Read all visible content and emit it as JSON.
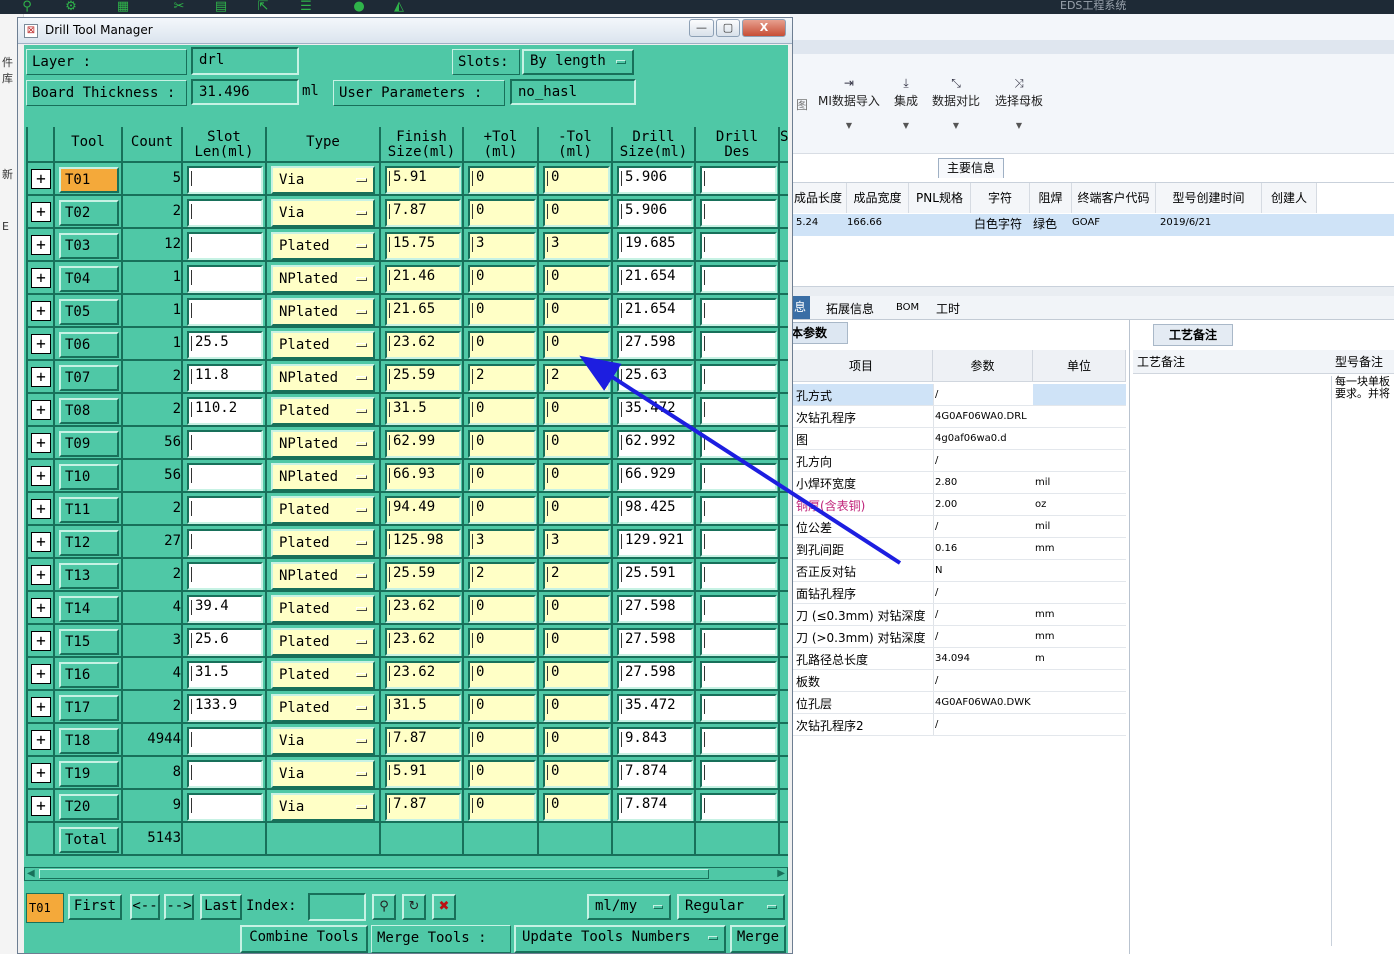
{
  "background_app": {
    "title": "EDS工程系统",
    "left_strip": [
      "件库",
      "新",
      "E"
    ],
    "ribbon": [
      {
        "label": "MI数据导入"
      },
      {
        "label": "集成"
      },
      {
        "label": "数据对比"
      },
      {
        "label": "选择母板"
      }
    ],
    "ribbon_partial": "图",
    "main_info_tab": "主要信息",
    "info_columns": [
      "成品长度",
      "成品宽度",
      "PNL规格",
      "字符",
      "阻焊",
      "终端客户代码",
      "型号创建时间",
      "创建人"
    ],
    "info_row": {
      "length": "5.24",
      "width": "166.66",
      "char": "白色字符",
      "mask": "绿色",
      "client": "GOAF",
      "created": "2019/6/21"
    },
    "bottom_tabs": [
      "息",
      "拓展信息",
      "BOM",
      "工时"
    ],
    "param_tab": "本参数",
    "param_columns": [
      "项目",
      "参数",
      "单位"
    ],
    "params": [
      {
        "name": "孔方式",
        "value": "/",
        "unit": ""
      },
      {
        "name": "次钻孔程序",
        "value": "4G0AF06WA0.DRL",
        "unit": ""
      },
      {
        "name": "图",
        "value": "4g0af06wa0.d",
        "unit": ""
      },
      {
        "name": "孔方向",
        "value": "/",
        "unit": ""
      },
      {
        "name": "小焊环宽度",
        "value": "2.80",
        "unit": "mil"
      },
      {
        "name": "铜厚(含表铜)",
        "value": "2.00",
        "unit": "oz"
      },
      {
        "name": "位公差",
        "value": "/",
        "unit": "mil"
      },
      {
        "name": "到孔间距",
        "value": "0.16",
        "unit": "mm"
      },
      {
        "name": "否正反对钻",
        "value": "N",
        "unit": ""
      },
      {
        "name": "面钻孔程序",
        "value": "/",
        "unit": ""
      },
      {
        "name": "刀 (≤0.3mm) 对钻深度",
        "value": "/",
        "unit": "mm"
      },
      {
        "name": "刀 (>0.3mm) 对钻深度",
        "value": "/",
        "unit": "mm"
      },
      {
        "name": "孔路径总长度",
        "value": "34.094",
        "unit": "m"
      },
      {
        "name": "板数",
        "value": "/",
        "unit": ""
      },
      {
        "name": "位孔层",
        "value": "4G0AF06WA0.DWK",
        "unit": ""
      },
      {
        "name": "次钻孔程序2",
        "value": "/",
        "unit": ""
      }
    ],
    "craft_tab": "工艺备注",
    "craft_columns": [
      "工艺备注",
      "型号备注"
    ],
    "craft_note": "每一块单板\n要求。并将"
  },
  "window": {
    "title": "Drill Tool Manager",
    "min": "—",
    "max": "▢",
    "close": "X"
  },
  "top": {
    "layer_label": "Layer          :",
    "layer_value": "drl",
    "slots_label": "Slots:",
    "slots_value": "By length",
    "board_thickness_label": "Board Thickness :",
    "board_thickness_value": "31.496",
    "board_thickness_unit": "ml",
    "user_params_label": "User Parameters :",
    "user_params_value": "no_hasl"
  },
  "columns": {
    "tool": "Tool",
    "count": "Count",
    "slot_len_1": "Slot",
    "slot_len_2": "Len(ml)",
    "type": "Type",
    "finish_1": "Finish",
    "finish_2": "Size(ml)",
    "ptol_1": "+Tol",
    "ptol_2": "(ml)",
    "mtol_1": "-Tol",
    "mtol_2": "(ml)",
    "drill_1": "Drill",
    "drill_2": "Size(ml)",
    "des_1": "Drill",
    "des_2": "Des",
    "more": "S"
  },
  "tools": [
    {
      "icon": "+",
      "tool": "T01",
      "count": "5",
      "slot": "",
      "type": "Via",
      "finish": "5.91",
      "ptol": "0",
      "mtol": "0",
      "drill": "5.906",
      "des": ""
    },
    {
      "icon": "+",
      "tool": "T02",
      "count": "2",
      "slot": "",
      "type": "Via",
      "finish": "7.87",
      "ptol": "0",
      "mtol": "0",
      "drill": "5.906",
      "des": ""
    },
    {
      "icon": "+",
      "tool": "T03",
      "count": "12",
      "slot": "",
      "type": "Plated",
      "finish": "15.75",
      "ptol": "3",
      "mtol": "3",
      "drill": "19.685",
      "des": ""
    },
    {
      "icon": "+",
      "tool": "T04",
      "count": "1",
      "slot": "",
      "type": "NPlated",
      "finish": "21.46",
      "ptol": "0",
      "mtol": "0",
      "drill": "21.654",
      "des": ""
    },
    {
      "icon": "+",
      "tool": "T05",
      "count": "1",
      "slot": "",
      "type": "NPlated",
      "finish": "21.65",
      "ptol": "0",
      "mtol": "0",
      "drill": "21.654",
      "des": ""
    },
    {
      "icon": "+",
      "tool": "T06",
      "count": "1",
      "slot": "25.5",
      "type": "Plated",
      "finish": "23.62",
      "ptol": "0",
      "mtol": "0",
      "drill": "27.598",
      "des": ""
    },
    {
      "icon": "+",
      "tool": "T07",
      "count": "2",
      "slot": "11.8",
      "type": "NPlated",
      "finish": "25.59",
      "ptol": "2",
      "mtol": "2",
      "drill": "25.63",
      "des": ""
    },
    {
      "icon": "+",
      "tool": "T08",
      "count": "2",
      "slot": "110.2",
      "type": "Plated",
      "finish": "31.5",
      "ptol": "0",
      "mtol": "0",
      "drill": "35.472",
      "des": ""
    },
    {
      "icon": "+",
      "tool": "T09",
      "count": "56",
      "slot": "",
      "type": "NPlated",
      "finish": "62.99",
      "ptol": "0",
      "mtol": "0",
      "drill": "62.992",
      "des": ""
    },
    {
      "icon": "+",
      "tool": "T10",
      "count": "56",
      "slot": "",
      "type": "NPlated",
      "finish": "66.93",
      "ptol": "0",
      "mtol": "0",
      "drill": "66.929",
      "des": ""
    },
    {
      "icon": "+",
      "tool": "T11",
      "count": "2",
      "slot": "",
      "type": "Plated",
      "finish": "94.49",
      "ptol": "0",
      "mtol": "0",
      "drill": "98.425",
      "des": ""
    },
    {
      "icon": "+",
      "tool": "T12",
      "count": "27",
      "slot": "",
      "type": "Plated",
      "finish": "125.98",
      "ptol": "3",
      "mtol": "3",
      "drill": "129.921",
      "des": ""
    },
    {
      "icon": "+",
      "tool": "T13",
      "count": "2",
      "slot": "",
      "type": "NPlated",
      "finish": "25.59",
      "ptol": "2",
      "mtol": "2",
      "drill": "25.591",
      "des": ""
    },
    {
      "icon": "+",
      "tool": "T14",
      "count": "4",
      "slot": "39.4",
      "type": "Plated",
      "finish": "23.62",
      "ptol": "0",
      "mtol": "0",
      "drill": "27.598",
      "des": ""
    },
    {
      "icon": "+",
      "tool": "T15",
      "count": "3",
      "slot": "25.6",
      "type": "Plated",
      "finish": "23.62",
      "ptol": "0",
      "mtol": "0",
      "drill": "27.598",
      "des": ""
    },
    {
      "icon": "+",
      "tool": "T16",
      "count": "4",
      "slot": "31.5",
      "type": "Plated",
      "finish": "23.62",
      "ptol": "0",
      "mtol": "0",
      "drill": "27.598",
      "des": ""
    },
    {
      "icon": "+",
      "tool": "T17",
      "count": "2",
      "slot": "133.9",
      "type": "Plated",
      "finish": "31.5",
      "ptol": "0",
      "mtol": "0",
      "drill": "35.472",
      "des": ""
    },
    {
      "icon": "+",
      "tool": "T18",
      "count": "4944",
      "slot": "",
      "type": "Via",
      "finish": "7.87",
      "ptol": "0",
      "mtol": "0",
      "drill": "9.843",
      "des": ""
    },
    {
      "icon": "+",
      "tool": "T19",
      "count": "8",
      "slot": "",
      "type": "Via",
      "finish": "5.91",
      "ptol": "0",
      "mtol": "0",
      "drill": "7.874",
      "des": ""
    },
    {
      "icon": "+",
      "tool": "T20",
      "count": "9",
      "slot": "",
      "type": "Via",
      "finish": "7.87",
      "ptol": "0",
      "mtol": "0",
      "drill": "7.874",
      "des": ""
    }
  ],
  "total": {
    "label": "Total",
    "value": "5143"
  },
  "nav": {
    "current_tool": "T01",
    "first": "First",
    "prev": "<--",
    "next": "-->",
    "last": "Last",
    "index_label": "Index:",
    "index_value": "",
    "units": "ml/my",
    "mode": "Regular"
  },
  "bottom": {
    "combine": "Combine Tools",
    "merge_label": "Merge Tools :",
    "update": "Update Tools Numbers",
    "merge": "Merge"
  },
  "colors": {
    "panel": "#4fc8a6",
    "highlight": "#f4a93a",
    "field_yellow": "#ffffc6",
    "arrow": "#1d1ee0"
  }
}
